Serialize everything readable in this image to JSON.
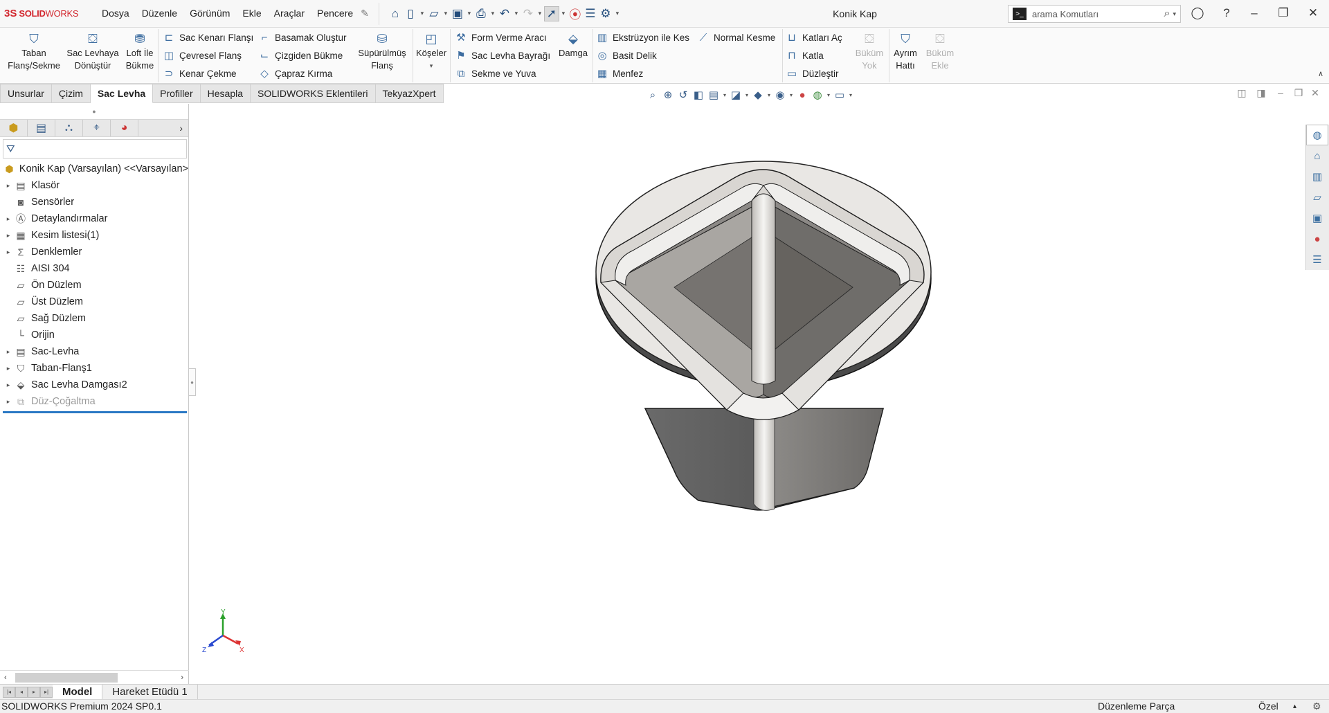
{
  "app": {
    "logo_ds": "3S",
    "logo_text_bold": "SOLID",
    "logo_text_light": "WORKS",
    "document_title": "Konik Kap"
  },
  "menu": [
    "Dosya",
    "Düzenle",
    "Görünüm",
    "Ekle",
    "Araçlar",
    "Pencere"
  ],
  "search": {
    "placeholder": "arama Komutları"
  },
  "ribbon": {
    "base_flange": "Taban Flanş/Sekme",
    "convert_to_sheet": "Sac Levhaya Dönüştür",
    "lofted_bend": "Loft İle Bükme",
    "edge_flange": "Sac Kenarı Flanşı",
    "miter_flange": "Çevresel Flanş",
    "hem": "Kenar Çekme",
    "jog": "Basamak Oluştur",
    "sketched_bend": "Çizgiden Bükme",
    "cross_break": "Çapraz Kırma",
    "swept_flange": "Süpürülmüş Flanş",
    "corners": "Köşeler",
    "forming_tool": "Form Verme Aracı",
    "tab_and_slot_flag": "Sac Levha Bayrağı",
    "tab_and_slot": "Sekme ve Yuva",
    "stamp": "Damga",
    "extruded_cut": "Ekstrüzyon ile Kes",
    "simple_hole": "Basit Delik",
    "vent": "Menfez",
    "normal_cut": "Normal Kesme",
    "unfold": "Katları Aç",
    "fold": "Katla",
    "flatten": "Düzleştir",
    "no_bends": "Büküm Yok",
    "rip": "Ayrım Hattı",
    "insert_bends": "Büküm Ekle"
  },
  "tabs": [
    "Unsurlar",
    "Çizim",
    "Sac Levha",
    "Profiller",
    "Hesapla",
    "SOLIDWORKS Eklentileri",
    "TekyazXpert"
  ],
  "active_tab": "Sac Levha",
  "tree": {
    "root": "Konik Kap (Varsayılan) <<Varsayılan>",
    "items": [
      {
        "label": "Klasör",
        "expandable": true,
        "icon": "folder-icon"
      },
      {
        "label": "Sensörler",
        "expandable": false,
        "icon": "sensor-icon"
      },
      {
        "label": "Detaylandırmalar",
        "expandable": true,
        "icon": "annotations-icon"
      },
      {
        "label": "Kesim listesi(1)",
        "expandable": true,
        "icon": "cut-list-icon"
      },
      {
        "label": "Denklemler",
        "expandable": true,
        "icon": "equations-icon"
      },
      {
        "label": "AISI 304",
        "expandable": false,
        "icon": "material-icon"
      },
      {
        "label": "Ön Düzlem",
        "expandable": false,
        "icon": "plane-icon"
      },
      {
        "label": "Üst Düzlem",
        "expandable": false,
        "icon": "plane-icon"
      },
      {
        "label": "Sağ Düzlem",
        "expandable": false,
        "icon": "plane-icon"
      },
      {
        "label": "Orijin",
        "expandable": false,
        "icon": "origin-icon"
      },
      {
        "label": "Sac-Levha",
        "expandable": true,
        "icon": "sheet-metal-icon"
      },
      {
        "label": "Taban-Flanş1",
        "expandable": true,
        "icon": "base-flange-icon"
      },
      {
        "label": "Sac Levha Damgası2",
        "expandable": true,
        "icon": "stamp-icon"
      },
      {
        "label": "Düz-Çoğaltma",
        "expandable": true,
        "icon": "linear-pattern-icon",
        "suppressed": true
      }
    ]
  },
  "bottom_tabs": [
    "Model",
    "Hareket Etüdü 1"
  ],
  "status": {
    "left": "SOLIDWORKS Premium 2024 SP0.1",
    "mode": "Düzenleme Parça",
    "units": "Özel"
  },
  "triad": {
    "x": "X",
    "y": "Y",
    "z": "Z"
  }
}
